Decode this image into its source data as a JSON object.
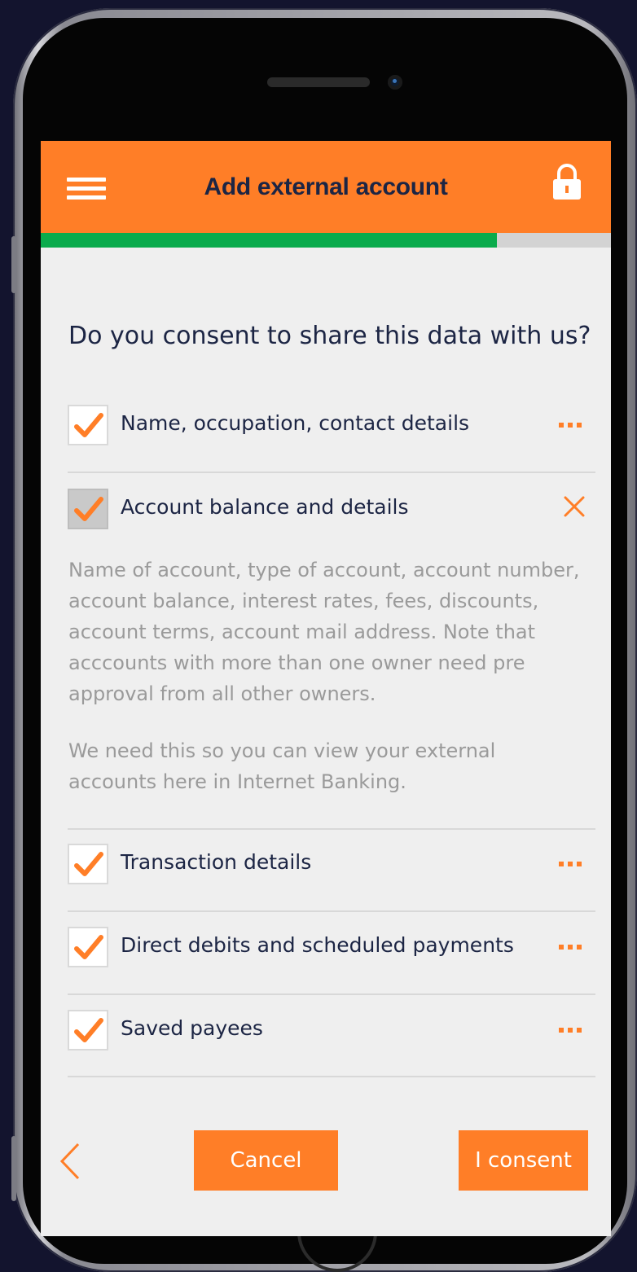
{
  "header": {
    "title": "Add external account",
    "menu_icon": "hamburger-menu-icon",
    "lock_icon": "lock-icon"
  },
  "progress": {
    "value": 0.8
  },
  "consent": {
    "question": "Do you consent to share this data with us?",
    "items": [
      {
        "label": "Name, occupation, contact details",
        "checked": true,
        "expanded": false
      },
      {
        "label": "Account balance and details",
        "checked": true,
        "expanded": true,
        "disabled": true
      },
      {
        "label": "Transaction details",
        "checked": true,
        "expanded": false
      },
      {
        "label": "Direct debits and scheduled payments",
        "checked": true,
        "expanded": false
      },
      {
        "label": "Saved payees",
        "checked": true,
        "expanded": false
      }
    ],
    "expanded_detail": {
      "paragraph1": "Name of account, type of account, account number, account balance, interest rates, fees, discounts, account terms, account mail address. Note that acccounts with more than one owner need pre approval from all other owners.",
      "paragraph2": "We need this so you can view your external accounts here in Internet Banking."
    }
  },
  "footer": {
    "back_icon": "chevron-left-icon",
    "cancel_label": "Cancel",
    "consent_label": "I consent"
  },
  "colors": {
    "accent": "#ff7e27",
    "progress": "#0aab4c",
    "text_dark": "#1c2544",
    "text_muted": "#9a9a9a",
    "background": "#efefef",
    "page_background": "#13142e"
  }
}
